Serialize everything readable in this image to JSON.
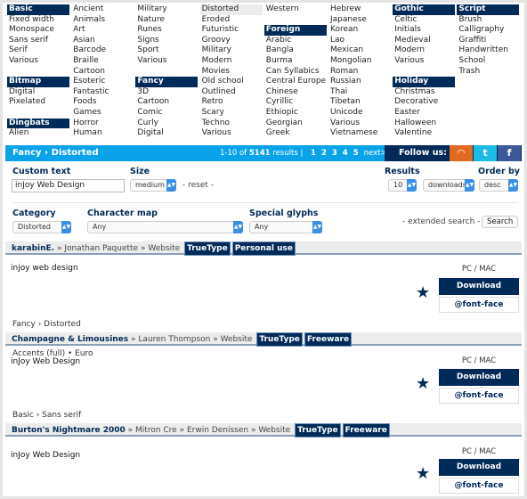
{
  "categories": [
    [
      {
        "t": "Basic",
        "h": true
      },
      {
        "t": "Fixed width"
      },
      {
        "t": "Monospace"
      },
      {
        "t": "Sans serif"
      },
      {
        "t": "Serif"
      },
      {
        "t": "Various"
      },
      {
        "t": ""
      },
      {
        "t": "Bitmap",
        "h": true
      },
      {
        "t": "Digital"
      },
      {
        "t": "Pixelated"
      },
      {
        "t": ""
      },
      {
        "t": "Dingbats",
        "h": true
      },
      {
        "t": "Alien"
      }
    ],
    [
      {
        "t": "Ancient"
      },
      {
        "t": "Animals"
      },
      {
        "t": "Art"
      },
      {
        "t": "Asian"
      },
      {
        "t": "Barcode"
      },
      {
        "t": "Braille"
      },
      {
        "t": "Cartoon"
      },
      {
        "t": "Esoteric"
      },
      {
        "t": "Fantastic"
      },
      {
        "t": "Foods"
      },
      {
        "t": "Games"
      },
      {
        "t": "Horror"
      },
      {
        "t": "Human"
      }
    ],
    [
      {
        "t": "Military"
      },
      {
        "t": "Nature"
      },
      {
        "t": "Runes"
      },
      {
        "t": "Signs"
      },
      {
        "t": "Sport"
      },
      {
        "t": "Various"
      },
      {
        "t": ""
      },
      {
        "t": "Fancy",
        "h": true
      },
      {
        "t": "3D"
      },
      {
        "t": "Cartoon"
      },
      {
        "t": "Comic"
      },
      {
        "t": "Curly"
      },
      {
        "t": "Digital"
      }
    ],
    [
      {
        "t": "Distorted",
        "sel": true
      },
      {
        "t": "Eroded"
      },
      {
        "t": "Futuristic"
      },
      {
        "t": "Groovy"
      },
      {
        "t": "Military"
      },
      {
        "t": "Modern"
      },
      {
        "t": "Movies"
      },
      {
        "t": "Old school"
      },
      {
        "t": "Outlined"
      },
      {
        "t": "Retro"
      },
      {
        "t": "Scary"
      },
      {
        "t": "Techno"
      },
      {
        "t": "Various"
      }
    ],
    [
      {
        "t": "Western"
      },
      {
        "t": ""
      },
      {
        "t": "Foreign",
        "h": true
      },
      {
        "t": "Arabic"
      },
      {
        "t": "Bangla"
      },
      {
        "t": "Burma"
      },
      {
        "t": "Can Syllabics"
      },
      {
        "t": "Central Europe"
      },
      {
        "t": "Chinese"
      },
      {
        "t": "Cyrillic"
      },
      {
        "t": "Ethiopic"
      },
      {
        "t": "Georgian"
      },
      {
        "t": "Greek"
      }
    ],
    [
      {
        "t": "Hebrew"
      },
      {
        "t": "Japanese"
      },
      {
        "t": "Korean"
      },
      {
        "t": "Lao"
      },
      {
        "t": "Mexican"
      },
      {
        "t": "Mongolian"
      },
      {
        "t": "Roman"
      },
      {
        "t": "Russian"
      },
      {
        "t": "Thai"
      },
      {
        "t": "Tibetan"
      },
      {
        "t": "Unicode"
      },
      {
        "t": "Various"
      },
      {
        "t": "Vietnamese"
      }
    ],
    [
      {
        "t": "Gothic",
        "h": true
      },
      {
        "t": "Celtic"
      },
      {
        "t": "Initials"
      },
      {
        "t": "Medieval"
      },
      {
        "t": "Modern"
      },
      {
        "t": "Various"
      },
      {
        "t": ""
      },
      {
        "t": "Holiday",
        "h": true
      },
      {
        "t": "Christmas"
      },
      {
        "t": "Decorative"
      },
      {
        "t": "Easter"
      },
      {
        "t": "Halloween"
      },
      {
        "t": "Valentine"
      }
    ],
    [
      {
        "t": "Script",
        "h": true
      },
      {
        "t": "Brush"
      },
      {
        "t": "Calligraphy"
      },
      {
        "t": "Graffiti"
      },
      {
        "t": "Handwritten"
      },
      {
        "t": "School"
      },
      {
        "t": "Trash"
      }
    ]
  ],
  "bar": {
    "crumb": "Fancy › Distorted",
    "range": "1-10 of ",
    "total": "5141",
    "results": " results |",
    "pages": [
      "1",
      "2",
      "3",
      "4",
      "5"
    ],
    "next": "next>",
    "follow": "Follow us:",
    "social": [
      {
        "icon": "rss-icon",
        "glyph": "◠",
        "color": "#e06a22"
      },
      {
        "icon": "twitter-icon",
        "glyph": "t",
        "color": "#1dbbe8"
      },
      {
        "icon": "facebook-icon",
        "glyph": "f",
        "color": "#3b5998"
      }
    ]
  },
  "form": {
    "custom_text_label": "Custom text",
    "custom_text_value": "inJoy Web Design",
    "size_label": "Size",
    "size_value": "medium",
    "reset": "- reset -",
    "results_label": "Results",
    "results_value": "10",
    "order_label": "Order by",
    "order_value": "downloads",
    "order_dir": "desc",
    "category_label": "Category",
    "category_value": "Distorted",
    "charmap_label": "Character map",
    "charmap_value": "Any",
    "glyphs_label": "Special glyphs",
    "glyphs_value": "Any",
    "extended": "- extended search -",
    "search": "Search"
  },
  "fonts": [
    {
      "name": "karabinE.",
      "authors": [
        "Jonathan Paquette",
        "Website"
      ],
      "tags": [
        "TrueType",
        "Personal use"
      ],
      "sample": "injoy web design",
      "platform": "PC / MAC",
      "download": "Download",
      "fontface": "@font-face",
      "category": "Fancy › Distorted",
      "meta": ""
    },
    {
      "name": "Champagne & Limousines",
      "authors": [
        "Lauren Thompson",
        "Website"
      ],
      "tags": [
        "TrueType",
        "Freeware"
      ],
      "sample": "inJoy Web Design",
      "platform": "PC / MAC",
      "download": "Download",
      "fontface": "@font-face",
      "category": "Basic › Sans serif",
      "meta": "Accents (full) • Euro"
    },
    {
      "name": "Burton's Nightmare 2000",
      "authors": [
        "Mitron Cre",
        "Erwin Denissen",
        "Website"
      ],
      "tags": [
        "TrueType",
        "Freeware"
      ],
      "sample": "inJoy Web Design",
      "platform": "PC / MAC",
      "download": "Download",
      "fontface": "@font-face",
      "category": "",
      "meta": ""
    }
  ],
  "colors": {
    "navy": "#002a57",
    "bar_blue": "#0aa3ea"
  }
}
